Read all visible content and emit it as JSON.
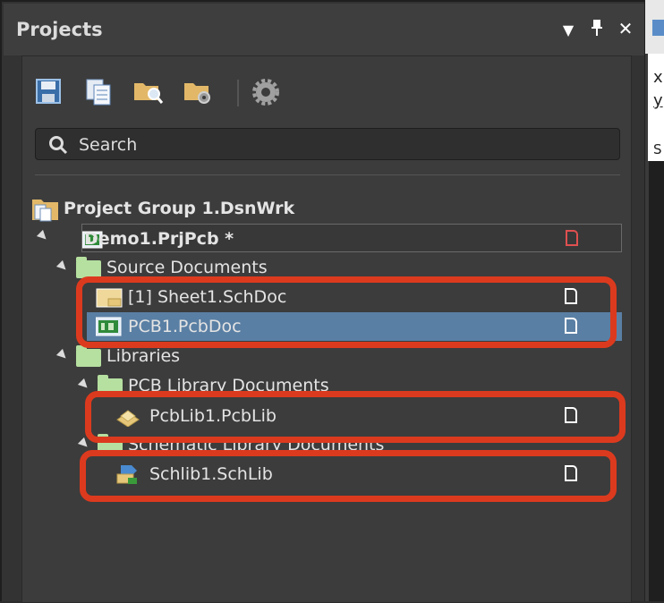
{
  "panel": {
    "title": "Projects",
    "buttons": {
      "menu": "▼",
      "pin": "📌",
      "close": "✕"
    }
  },
  "toolbar": {
    "icons": [
      "save-icon",
      "copy-documents-icon",
      "find-folder-icon",
      "folder-settings-icon",
      "gear-icon"
    ]
  },
  "search": {
    "placeholder": "Search",
    "value": ""
  },
  "tree": {
    "group": "Project Group 1.DsnWrk",
    "project": "Demo1.PrjPcb *",
    "source_folder": "Source Documents",
    "sheet": "[1] Sheet1.SchDoc",
    "pcb": "PCB1.PcbDoc",
    "libraries_folder": "Libraries",
    "pcb_lib_folder": "PCB Library Documents",
    "pcb_lib": "PcbLib1.PcbLib",
    "sch_lib_folder": "Schematic Library Documents",
    "sch_lib": "Schlib1.SchLib"
  },
  "side_text": {
    "x": "x",
    "y": "y",
    "s": "S"
  },
  "colors": {
    "selection": "#5a7fa4",
    "annotation": "#dc3a1e",
    "modified": "#e05050"
  }
}
